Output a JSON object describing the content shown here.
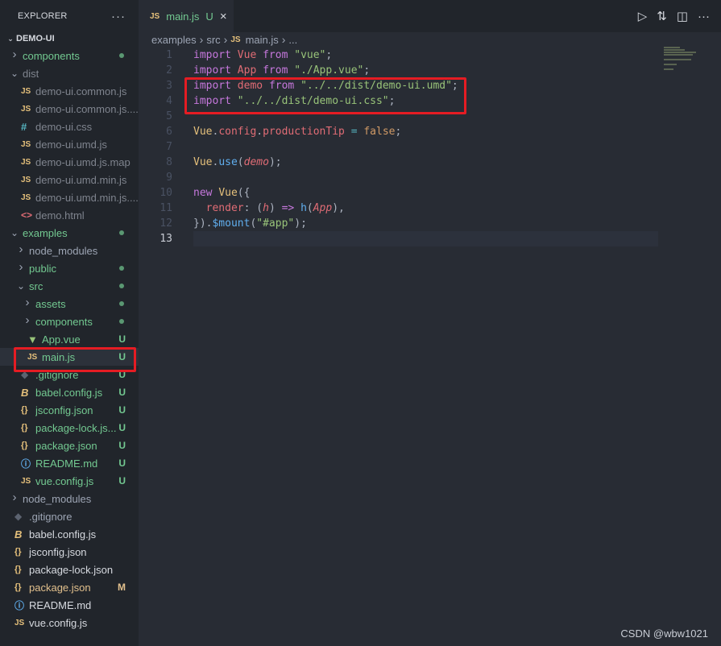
{
  "sidebar": {
    "title": "EXPLORER",
    "more": "···",
    "root": "DEMO-UI",
    "items": [
      {
        "label": "components",
        "badge": "",
        "dot": true,
        "kind": "folder"
      },
      {
        "label": "dist",
        "badge": "",
        "dot": false,
        "kind": "folder-open"
      },
      {
        "label": "demo-ui.common.js",
        "badge": "",
        "icon": "JS"
      },
      {
        "label": "demo-ui.common.js....",
        "badge": "",
        "icon": "JS"
      },
      {
        "label": "demo-ui.css",
        "badge": "",
        "icon": "#"
      },
      {
        "label": "demo-ui.umd.js",
        "badge": "",
        "icon": "JS"
      },
      {
        "label": "demo-ui.umd.js.map",
        "badge": "",
        "icon": "JS"
      },
      {
        "label": "demo-ui.umd.min.js",
        "badge": "",
        "icon": "JS"
      },
      {
        "label": "demo-ui.umd.min.js....",
        "badge": "",
        "icon": "JS"
      },
      {
        "label": "demo.html",
        "badge": "",
        "icon": "<>"
      },
      {
        "label": "examples",
        "badge": "",
        "dot": true,
        "kind": "folder-open"
      },
      {
        "label": "node_modules",
        "badge": "",
        "kind": "folder"
      },
      {
        "label": "public",
        "badge": "",
        "dot": true,
        "kind": "folder"
      },
      {
        "label": "src",
        "badge": "",
        "dot": true,
        "kind": "folder-open"
      },
      {
        "label": "assets",
        "badge": "",
        "dot": true,
        "kind": "folder"
      },
      {
        "label": "components",
        "badge": "",
        "dot": true,
        "kind": "folder"
      },
      {
        "label": "App.vue",
        "badge": "U",
        "icon": "V"
      },
      {
        "label": "main.js",
        "badge": "U",
        "icon": "JS"
      },
      {
        "label": ".gitignore",
        "badge": "U",
        "icon": "git"
      },
      {
        "label": "babel.config.js",
        "badge": "U",
        "icon": "B"
      },
      {
        "label": "jsconfig.json",
        "badge": "U",
        "icon": "{}"
      },
      {
        "label": "package-lock.js...",
        "badge": "U",
        "icon": "{}"
      },
      {
        "label": "package.json",
        "badge": "U",
        "icon": "{}"
      },
      {
        "label": "README.md",
        "badge": "U",
        "icon": "i"
      },
      {
        "label": "vue.config.js",
        "badge": "U",
        "icon": "JS"
      },
      {
        "label": "node_modules",
        "badge": "",
        "kind": "folder"
      },
      {
        "label": ".gitignore",
        "badge": "",
        "icon": "git"
      },
      {
        "label": "babel.config.js",
        "badge": "",
        "icon": "B"
      },
      {
        "label": "jsconfig.json",
        "badge": "",
        "icon": "{}"
      },
      {
        "label": "package-lock.json",
        "badge": "",
        "icon": "{}"
      },
      {
        "label": "package.json",
        "badge": "M",
        "icon": "{}"
      },
      {
        "label": "README.md",
        "badge": "",
        "icon": "i"
      },
      {
        "label": "vue.config.js",
        "badge": "",
        "icon": "JS"
      }
    ]
  },
  "tab": {
    "icon": "JS",
    "name": "main.js",
    "status": "U",
    "close": "×"
  },
  "breadcrumb": [
    "examples",
    "src",
    "main.js",
    "..."
  ],
  "code": {
    "line_numbers": [
      "1",
      "2",
      "3",
      "4",
      "5",
      "6",
      "7",
      "8",
      "9",
      "10",
      "11",
      "12",
      "13"
    ],
    "l1": {
      "kw": "import",
      "id": "Vue",
      "from": "from",
      "str": "\"vue\"",
      "end": ";"
    },
    "l2": {
      "kw": "import",
      "id": "App",
      "from": "from",
      "str": "\"./App.vue\"",
      "end": ";"
    },
    "l3": {
      "kw": "import",
      "id": "demo",
      "from": "from",
      "str": "\"../../dist/demo-ui.umd\"",
      "end": ";"
    },
    "l4": {
      "kw": "import",
      "str": "\"../../dist/demo-ui.css\"",
      "end": ";"
    },
    "l6": {
      "obj": "Vue",
      "p1": "config",
      "p2": "productionTip",
      "eq": "=",
      "val": "false",
      "end": ";"
    },
    "l8": {
      "obj": "Vue",
      "fn": "use",
      "arg": "demo",
      "end": ");"
    },
    "l10": {
      "kw": "new",
      "cls": "Vue",
      "open": "({"
    },
    "l11": {
      "prop": "render",
      "param": "h",
      "arrow": "=>",
      "fn": "h",
      "arg": "App",
      "end": "),"
    },
    "l12": {
      "close": "})",
      "fn": "$mount",
      "str": "\"#app\"",
      "end": ");"
    }
  },
  "watermark": "CSDN @wbw1021",
  "colors": {
    "highlight_box": "#e51c23",
    "untracked": "#73c991",
    "modified": "#e2c08d"
  }
}
